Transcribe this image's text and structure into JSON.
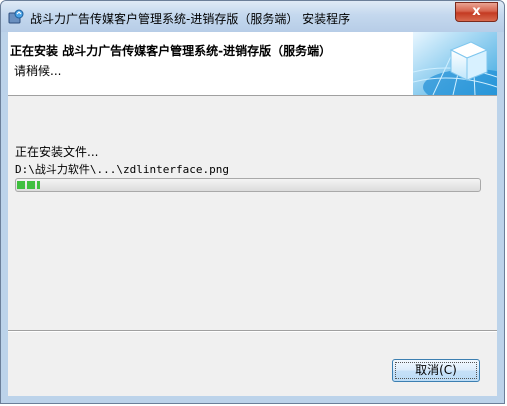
{
  "window": {
    "title": "战斗力广告传媒客户管理系统-进销存版（服务端） 安装程序",
    "close_label": "x"
  },
  "header": {
    "title": "正在安装 战斗力广告传媒客户管理系统-进销存版（服务端）",
    "subtitle": "请稍候..."
  },
  "body": {
    "status": "正在安装文件...",
    "file_path": "D:\\战斗力软件\\...\\zdlinterface.png",
    "progress": 0.05
  },
  "footer": {
    "cancel_label": "取消(C)"
  },
  "colors": {
    "progress_green": "#3fbf3f",
    "close_red": "#c43a22",
    "dialog_bg": "#f0f0f0"
  },
  "icons": [
    "installer-icon",
    "close-icon",
    "header-cube-icon"
  ]
}
